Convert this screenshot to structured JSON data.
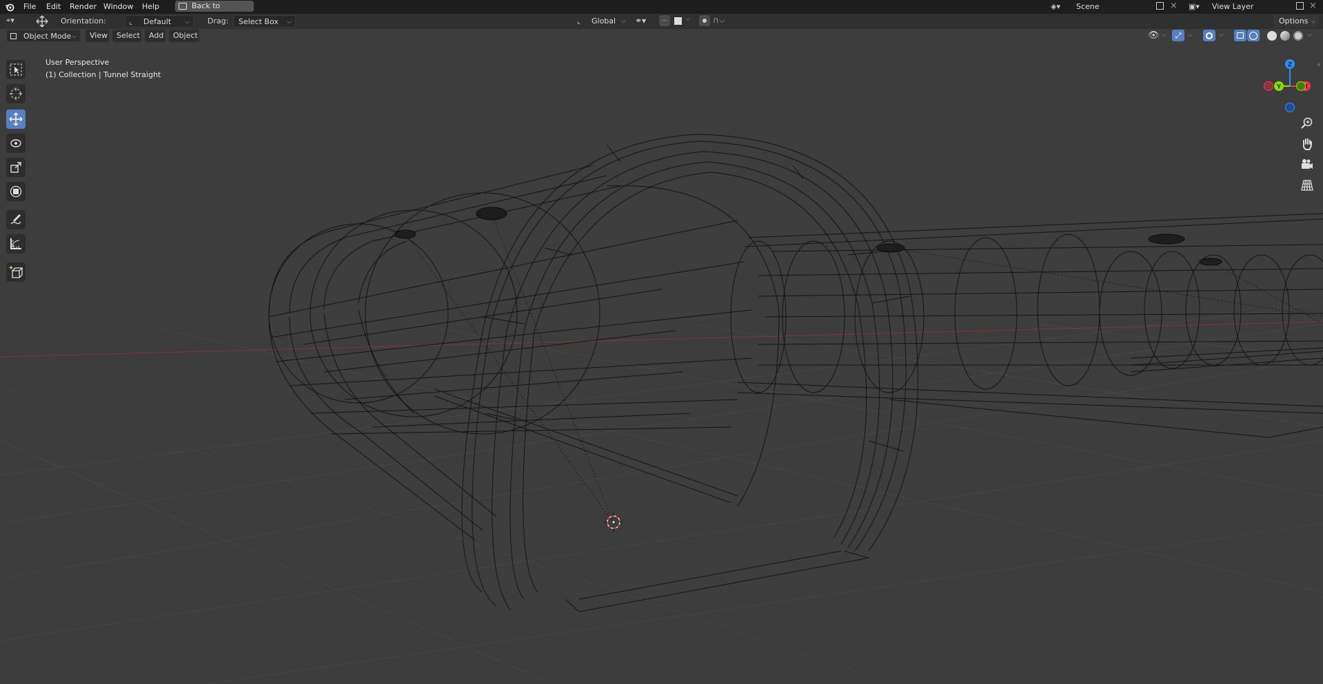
{
  "menubar": {
    "items": [
      {
        "label": "File"
      },
      {
        "label": "Edit"
      },
      {
        "label": "Render"
      },
      {
        "label": "Window"
      },
      {
        "label": "Help"
      }
    ],
    "back_button": "Back to Previous",
    "scene": "Scene",
    "view_layer": "View Layer"
  },
  "tool_header": {
    "orientation_label": "Orientation:",
    "orientation_value": "Default",
    "drag_label": "Drag:",
    "drag_value": "Select Box",
    "transform_orientation": "Global",
    "options_label": "Options"
  },
  "view_header": {
    "mode": "Object Mode",
    "menus": [
      {
        "label": "View"
      },
      {
        "label": "Select"
      },
      {
        "label": "Add"
      },
      {
        "label": "Object"
      }
    ]
  },
  "viewport": {
    "perspective_text": "User Perspective",
    "collection_text": "(1) Collection | Tunnel Straight"
  },
  "gizmo": {
    "z_label": "Z",
    "y_label": "Y",
    "x_label": "X",
    "z_color": "#2c8fff",
    "y_color": "#8bdc00",
    "x_color": "#ff3352"
  },
  "toolbar": {
    "tools": [
      "select-box-tool",
      "cursor-tool",
      "move-tool",
      "rotate-tool",
      "scale-tool",
      "transform-tool",
      "annotate-tool",
      "measure-tool",
      "add-cube-tool"
    ],
    "active_tool": "move-tool"
  },
  "colors": {
    "accent": "#5680c2",
    "background": "#3d3d3d",
    "x_axis_line": "#8a3434"
  }
}
